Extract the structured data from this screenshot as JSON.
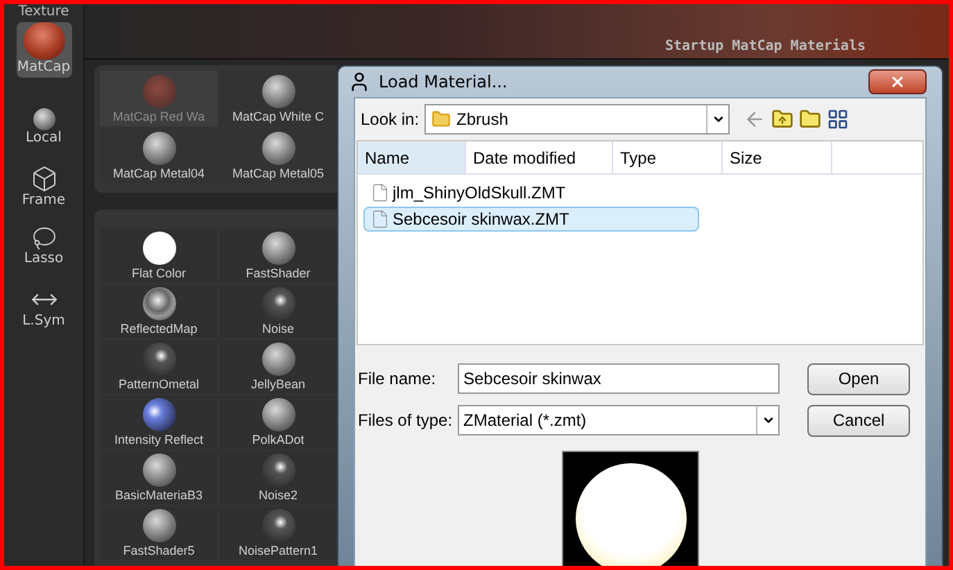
{
  "left_toolbar": {
    "top_label": "Texture",
    "items": [
      {
        "label": "MatCap",
        "kind": "material"
      },
      {
        "label": "Local",
        "kind": "local"
      },
      {
        "label": "Frame",
        "kind": "frame"
      },
      {
        "label": "Lasso",
        "kind": "lasso"
      },
      {
        "label": "L.Sym",
        "kind": "lsym"
      }
    ]
  },
  "header": {
    "title": "Startup MatCap Materials"
  },
  "matcap_panel": {
    "items": [
      {
        "label": "MatCap Red Wa",
        "dimmed": true
      },
      {
        "label": "MatCap White C",
        "dimmed": false
      },
      {
        "label": "MatCap Metal04",
        "dimmed": false
      },
      {
        "label": "MatCap Metal05",
        "dimmed": false
      }
    ]
  },
  "materials_panel": {
    "items": [
      {
        "label": "Flat Color",
        "kind": "flat"
      },
      {
        "label": "FastShader",
        "kind": "shaded"
      },
      {
        "label": "ReflectedMap",
        "kind": "reflect"
      },
      {
        "label": "Noise",
        "kind": "dark"
      },
      {
        "label": "PatternOmetal",
        "kind": "dark"
      },
      {
        "label": "JellyBean",
        "kind": "shaded"
      },
      {
        "label": "Intensity Reflect",
        "kind": "blue"
      },
      {
        "label": "PolkADot",
        "kind": "shaded"
      },
      {
        "label": "BasicMateriaB3",
        "kind": "shaded"
      },
      {
        "label": "Noise2",
        "kind": "dark"
      },
      {
        "label": "FastShader5",
        "kind": "shaded"
      },
      {
        "label": "NoisePattern1",
        "kind": "dark"
      }
    ]
  },
  "dialog": {
    "title": "Load Material...",
    "look_in": {
      "label": "Look in:",
      "value": "Zbrush"
    },
    "columns": [
      "Name",
      "Date modified",
      "Type",
      "Size"
    ],
    "files": [
      {
        "name": "jlm_ShinyOldSkull.ZMT",
        "selected": false
      },
      {
        "name": "Sebcesoir skinwax.ZMT",
        "selected": true
      }
    ],
    "file_name": {
      "label": "File name:",
      "value": "Sebcesoir skinwax"
    },
    "file_type": {
      "label": "Files of type:",
      "value": "ZMaterial (*.zmt)"
    },
    "buttons": [
      "Open",
      "Cancel"
    ]
  }
}
